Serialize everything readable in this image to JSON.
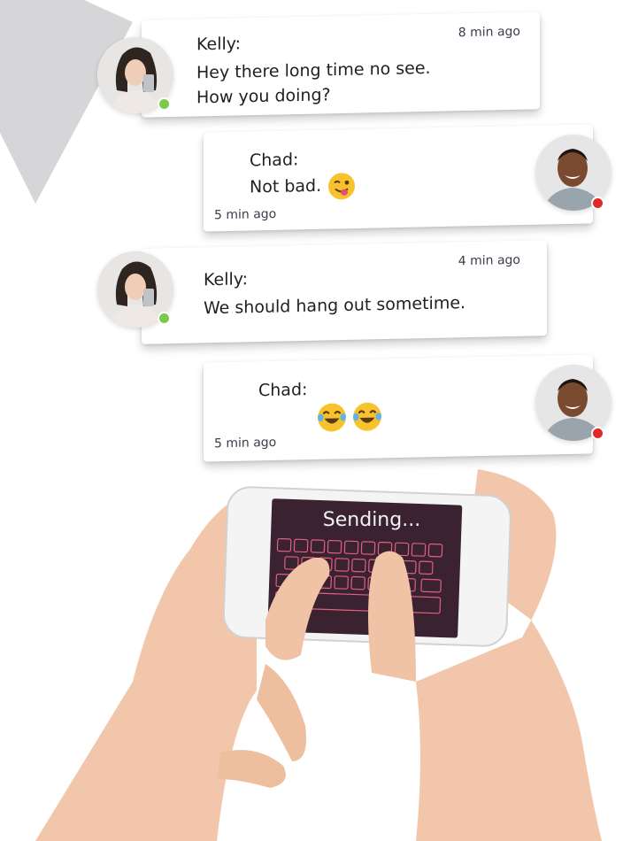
{
  "messages": [
    {
      "sender": "Kelly:",
      "text_line1": "Hey there long time no see.",
      "text_line2": "How you doing?",
      "time": "8 min ago",
      "status": "online"
    },
    {
      "sender": "Chad:",
      "text_line1": "Not bad.",
      "emoji": "winking-tongue-face-icon",
      "time": "5 min ago",
      "status": "offline"
    },
    {
      "sender": "Kelly:",
      "text_line1": "We should hang out sometime.",
      "time": "4 min ago",
      "status": "online"
    },
    {
      "sender": "Chad:",
      "emoji": "laughing-tears-face-icon",
      "emoji_count": 2,
      "time": "5 min ago",
      "status": "offline"
    }
  ],
  "phone": {
    "screen_text": "Sending..."
  },
  "colors": {
    "online": "#7cc94b",
    "offline": "#e02828",
    "emoji_yellow": "#f7c22b",
    "screen_bg": "#3a2230",
    "key_outline": "#e0607f",
    "skin": "#f3c8ad"
  }
}
